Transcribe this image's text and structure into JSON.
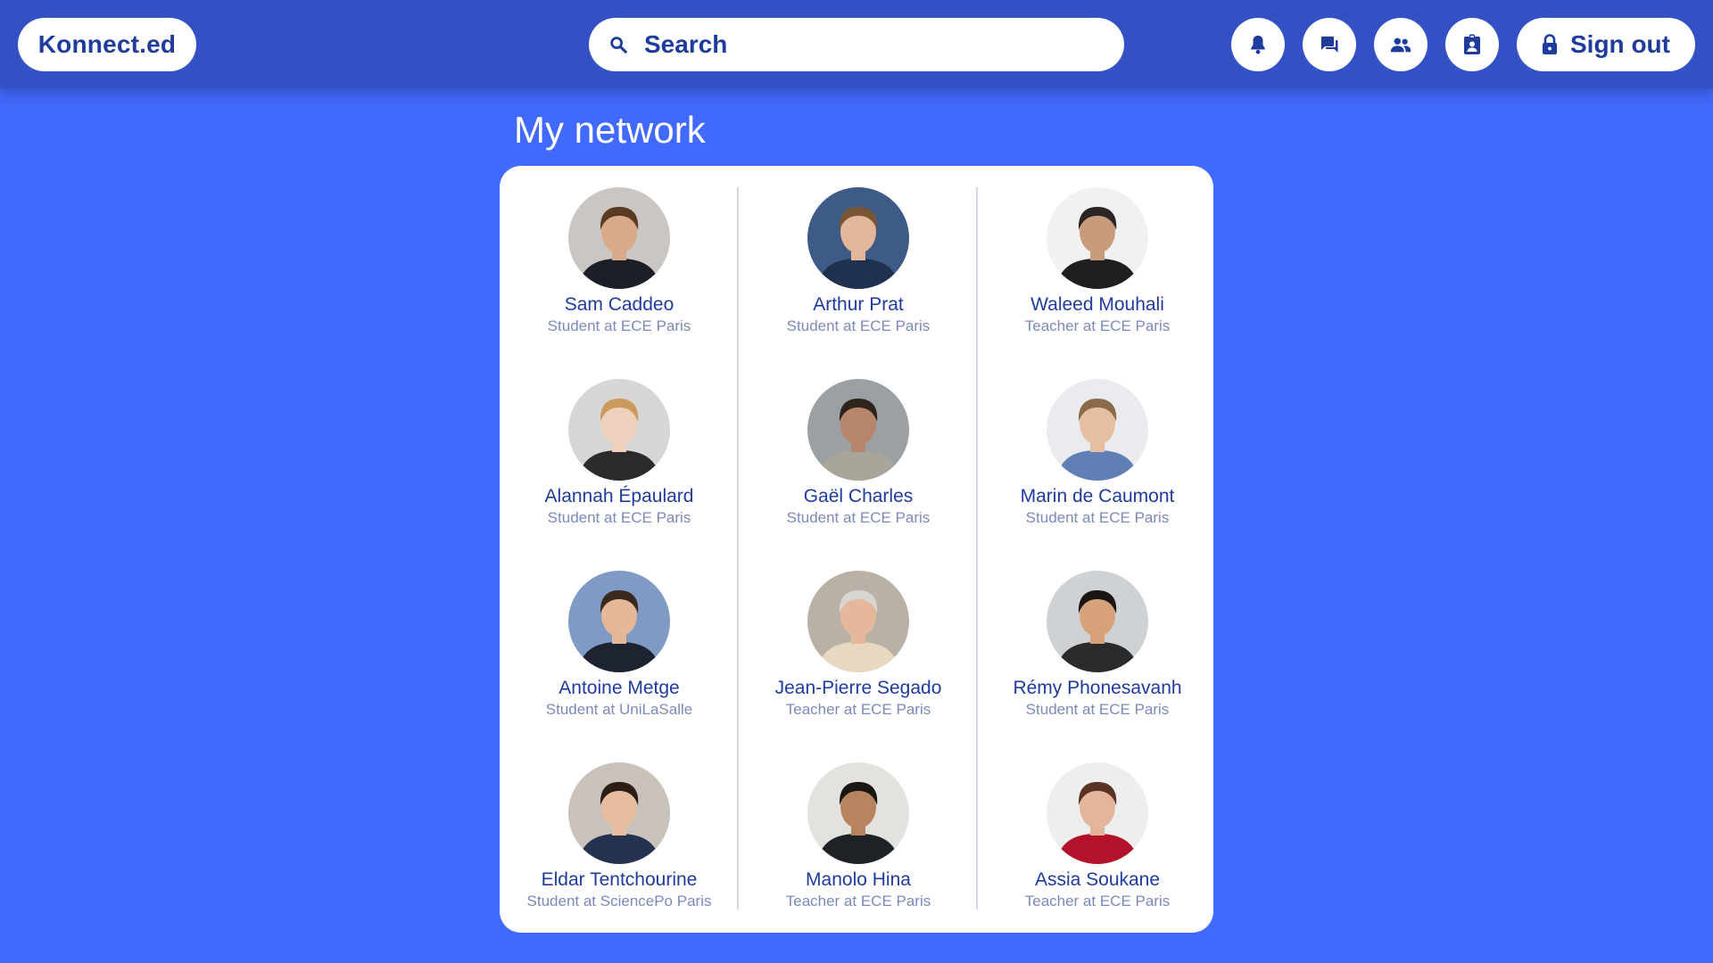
{
  "header": {
    "logo": "Konnect.ed",
    "search_placeholder": "Search",
    "signout_label": "Sign out",
    "icons": [
      "bell-icon",
      "chat-icon",
      "people-icon",
      "profile-badge-icon",
      "lock-icon"
    ]
  },
  "main": {
    "title": "My network"
  },
  "people": [
    {
      "name": "Sam Caddeo",
      "role": "Student at ECE Paris",
      "bg": "#c9c6c3",
      "skin": "#d9a98a",
      "hair": "#5a3a22",
      "shirt": "#1c1f26"
    },
    {
      "name": "Arthur Prat",
      "role": "Student at ECE Paris",
      "bg": "#3e5a86",
      "skin": "#e3b89a",
      "hair": "#7a5533",
      "shirt": "#20304f"
    },
    {
      "name": "Waleed Mouhali",
      "role": "Teacher at ECE Paris",
      "bg": "#f1f1f1",
      "skin": "#c99b7d",
      "hair": "#2a2522",
      "shirt": "#1f1f1f"
    },
    {
      "name": "Alannah Épaulard",
      "role": "Student at ECE Paris",
      "bg": "#d8d6d4",
      "skin": "#efd0bd",
      "hair": "#c89a5c",
      "shirt": "#2b2b2b"
    },
    {
      "name": "Gaël Charles",
      "role": "Student at ECE Paris",
      "bg": "#9aa0a3",
      "skin": "#b7866a",
      "hair": "#2d241c",
      "shirt": "#a9a59a"
    },
    {
      "name": "Marin de Caumont",
      "role": "Student at ECE Paris",
      "bg": "#e9ebee",
      "skin": "#e6bfa2",
      "hair": "#8a6a48",
      "shirt": "#5f7fb5"
    },
    {
      "name": "Antoine Metge",
      "role": "Student at UniLaSalle",
      "bg": "#7f9ac4",
      "skin": "#e3b798",
      "hair": "#3a2a1e",
      "shirt": "#1d2330"
    },
    {
      "name": "Jean-Pierre Segado",
      "role": "Teacher at ECE Paris",
      "bg": "#b9b0a6",
      "skin": "#e6b89b",
      "hair": "#d8d6d2",
      "shirt": "#e8d8c0"
    },
    {
      "name": "Rémy Phonesavanh",
      "role": "Student at ECE Paris",
      "bg": "#cfd2d5",
      "skin": "#d7a27a",
      "hair": "#1a1512",
      "shirt": "#2a2a2a"
    },
    {
      "name": "Eldar Tentchourine",
      "role": "Student at SciencePo Paris",
      "bg": "#c8c2bb",
      "skin": "#e7bda0",
      "hair": "#2a1e16",
      "shirt": "#24324f"
    },
    {
      "name": "Manolo Hina",
      "role": "Teacher at ECE Paris",
      "bg": "#e4e2df",
      "skin": "#b8845f",
      "hair": "#1a1614",
      "shirt": "#1e2126"
    },
    {
      "name": "Assia Soukane",
      "role": "Teacher at ECE Paris",
      "bg": "#eeeeee",
      "skin": "#e3b59a",
      "hair": "#5a3324",
      "shirt": "#b4122a"
    }
  ]
}
